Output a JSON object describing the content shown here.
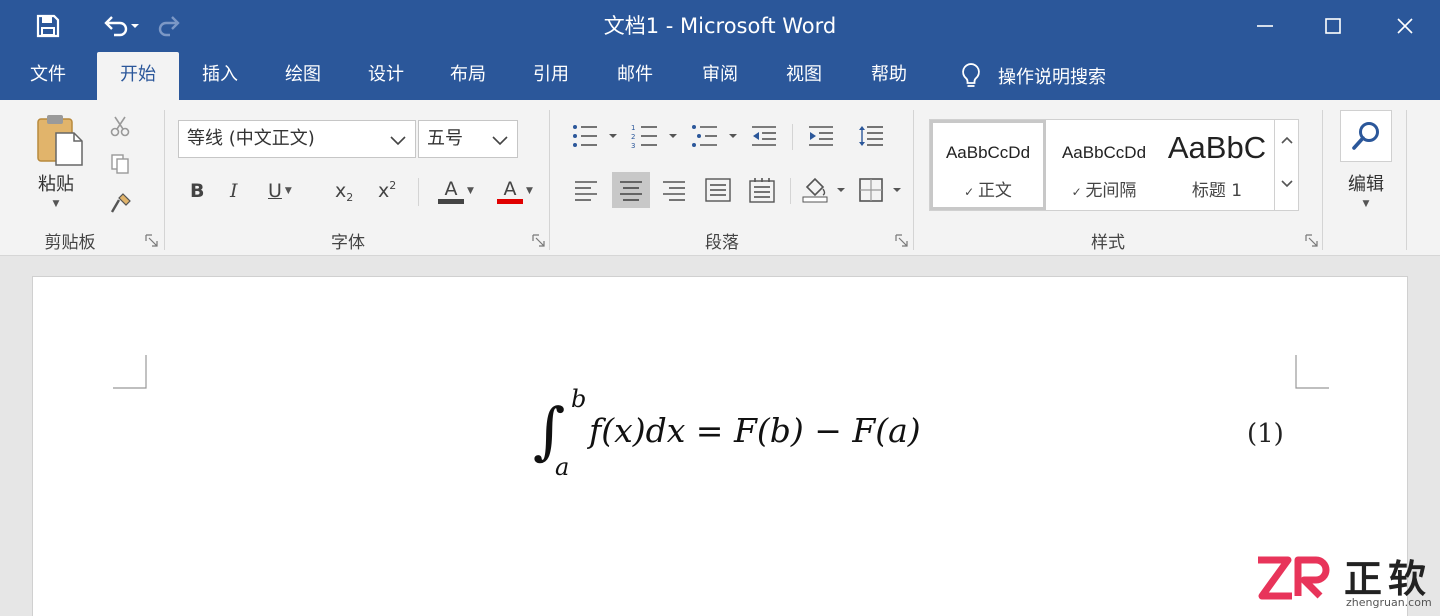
{
  "titlebar": {
    "title": "文档1  -  Microsoft Word",
    "bg_color": "#2b579a"
  },
  "quick_access": [
    "save-icon",
    "undo-icon",
    "redo-icon"
  ],
  "tabs": [
    {
      "label": "文件"
    },
    {
      "label": "开始"
    },
    {
      "label": "插入"
    },
    {
      "label": "绘图"
    },
    {
      "label": "设计"
    },
    {
      "label": "布局"
    },
    {
      "label": "引用"
    },
    {
      "label": "邮件"
    },
    {
      "label": "审阅"
    },
    {
      "label": "视图"
    },
    {
      "label": "帮助"
    }
  ],
  "active_tab": "开始",
  "tell_me": "操作说明搜索",
  "ribbon": {
    "clipboard": {
      "paste_label": "粘贴",
      "group_label": "剪贴板"
    },
    "font": {
      "font_name": "等线 (中文正文)",
      "font_size": "五号",
      "group_label": "字体",
      "bold": "B",
      "italic": "I",
      "underline": "U",
      "subscript": "x",
      "superscript": "x",
      "highlight_letter": "A",
      "font_color_letter": "A",
      "underline_color": "#444444",
      "font_color": "#e00000"
    },
    "paragraph": {
      "group_label": "段落"
    },
    "styles": {
      "group_label": "样式",
      "items": [
        {
          "preview": "AaBbCcDd",
          "name": "正文"
        },
        {
          "preview": "AaBbCcDd",
          "name": "无间隔"
        },
        {
          "preview": "AaBbC",
          "name": "标题 1"
        }
      ]
    },
    "editing": {
      "label": "编辑"
    }
  },
  "document": {
    "equation": {
      "upper": "b",
      "lower": "a",
      "body": "f(x)dx = F(b) − F(a)"
    },
    "equation_number": "(1)"
  },
  "watermark": {
    "brand": "正软",
    "url": "zhengruan.com"
  }
}
